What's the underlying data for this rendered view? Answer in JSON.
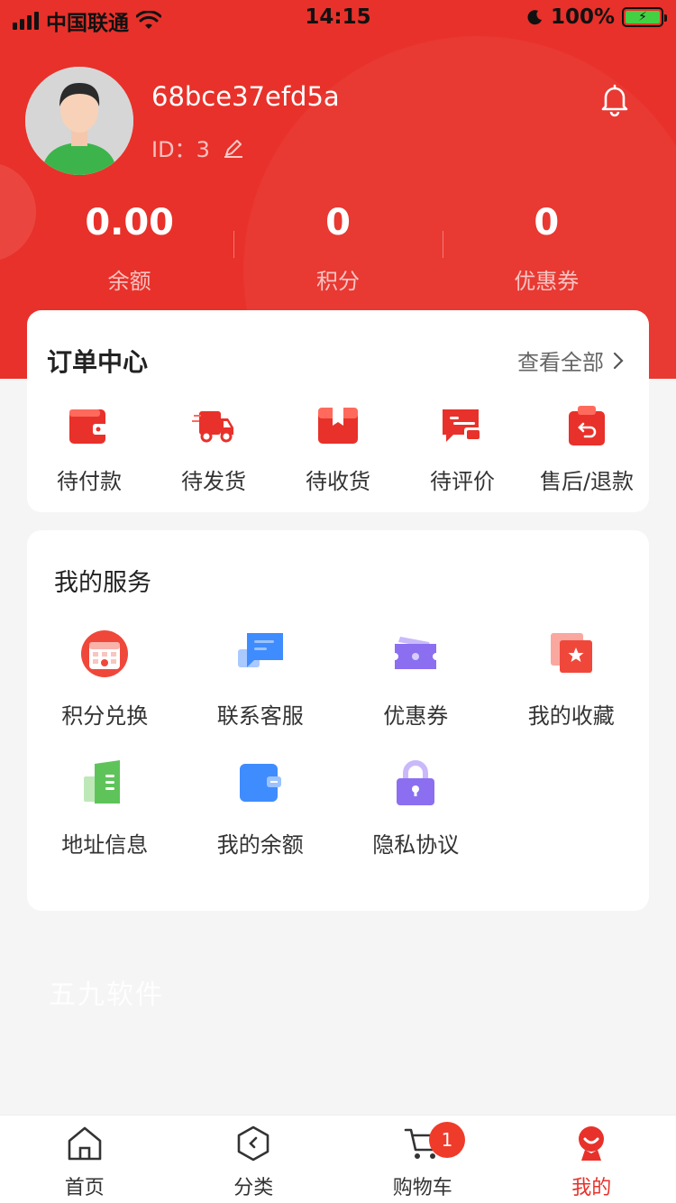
{
  "status_bar": {
    "carrier": "中国联通",
    "time": "14:15",
    "battery": "100%"
  },
  "profile": {
    "username": "68bce37efd5a",
    "id_label": "ID：",
    "id_value": "3"
  },
  "stats": [
    {
      "value": "0.00",
      "label": "余额"
    },
    {
      "value": "0",
      "label": "积分"
    },
    {
      "value": "0",
      "label": "优惠券"
    }
  ],
  "order_center": {
    "title": "订单中心",
    "view_all": "查看全部",
    "items": [
      {
        "label": "待付款",
        "icon": "wallet-icon"
      },
      {
        "label": "待发货",
        "icon": "truck-icon"
      },
      {
        "label": "待收货",
        "icon": "box-icon"
      },
      {
        "label": "待评价",
        "icon": "comment-icon"
      },
      {
        "label": "售后/退款",
        "icon": "refund-icon"
      }
    ]
  },
  "services": {
    "title": "我的服务",
    "items": [
      {
        "label": "积分兑换",
        "icon": "calendar-icon"
      },
      {
        "label": "联系客服",
        "icon": "chat-icon"
      },
      {
        "label": "优惠券",
        "icon": "coupon-icon"
      },
      {
        "label": "我的收藏",
        "icon": "favorite-icon"
      },
      {
        "label": "地址信息",
        "icon": "address-book-icon"
      },
      {
        "label": "我的余额",
        "icon": "wallet-icon"
      },
      {
        "label": "隐私协议",
        "icon": "lock-icon"
      }
    ]
  },
  "watermark": "五九软件",
  "tabbar": {
    "items": [
      {
        "label": "首页",
        "icon": "home-icon"
      },
      {
        "label": "分类",
        "icon": "category-icon"
      },
      {
        "label": "购物车",
        "icon": "cart-icon"
      },
      {
        "label": "我的",
        "icon": "profile-icon"
      }
    ],
    "cart_badge": "1",
    "active_index": 3
  },
  "colors": {
    "brand": "#e8312a",
    "green_avatar": "#3cb44b",
    "blue": "#3f8cff",
    "purple": "#8b6ff0",
    "green_icon": "#5ec45a"
  }
}
